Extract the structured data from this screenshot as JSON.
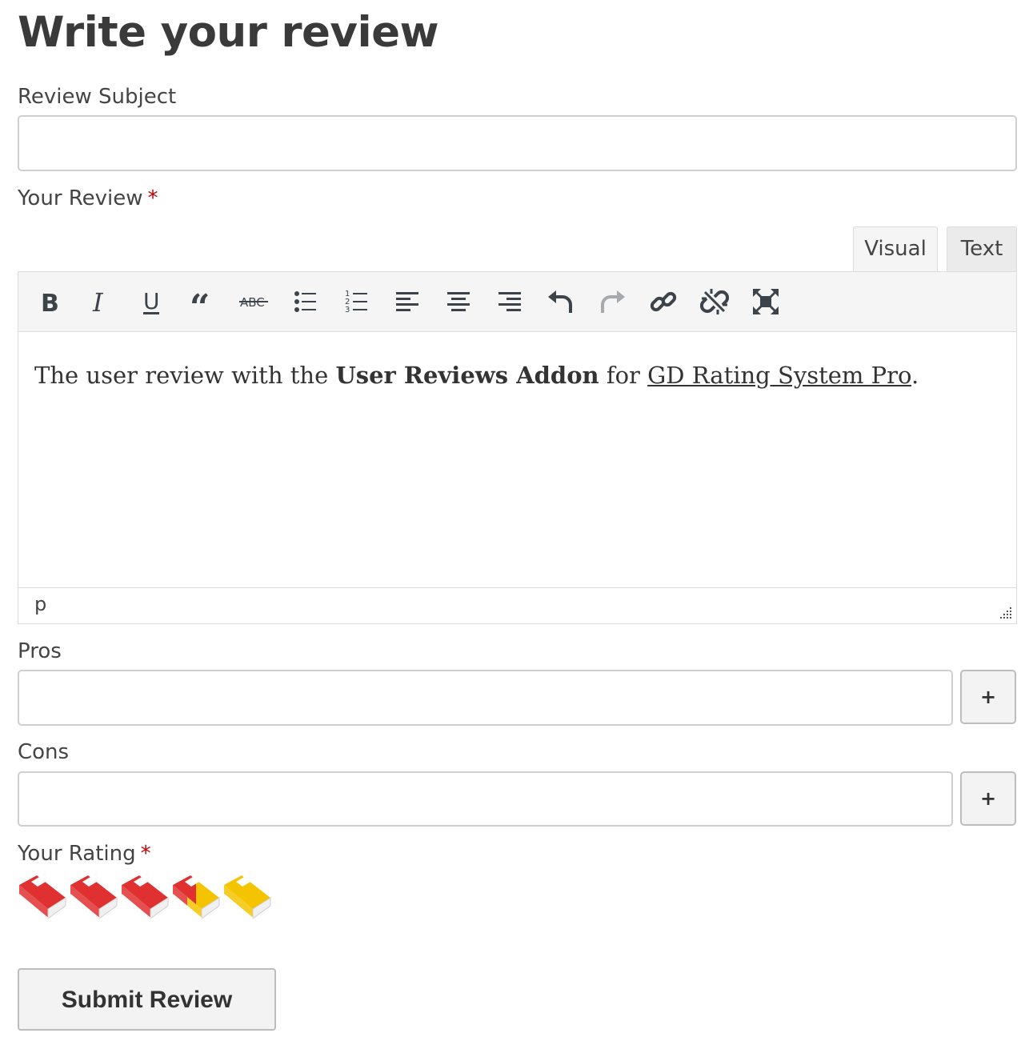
{
  "page": {
    "title": "Write your review"
  },
  "subject": {
    "label": "Review Subject",
    "value": ""
  },
  "review": {
    "label": "Your Review",
    "required_mark": "*",
    "tabs": {
      "visual": "Visual",
      "text": "Text"
    },
    "toolbar_icons": [
      "bold-icon",
      "italic-icon",
      "underline-icon",
      "blockquote-icon",
      "strikethrough-icon",
      "bullet-list-icon",
      "numbered-list-icon",
      "align-left-icon",
      "align-center-icon",
      "align-right-icon",
      "undo-icon",
      "redo-icon",
      "insert-link-icon",
      "remove-link-icon",
      "fullscreen-icon"
    ],
    "content": {
      "text_before": "The user review with the ",
      "bold_text": "User Reviews Addon",
      "text_middle": " for ",
      "link_text": "GD Rating System Pro",
      "text_after": "."
    },
    "path": "p"
  },
  "pros": {
    "label": "Pros",
    "value": "",
    "add_label": "+"
  },
  "cons": {
    "label": "Cons",
    "value": "",
    "add_label": "+"
  },
  "rating": {
    "label": "Your Rating",
    "required_mark": "*",
    "max": 5,
    "value": 3.5,
    "icon": "book-icon",
    "active_color": "#e03030",
    "inactive_color": "#f5c400"
  },
  "submit": {
    "label": "Submit Review"
  }
}
